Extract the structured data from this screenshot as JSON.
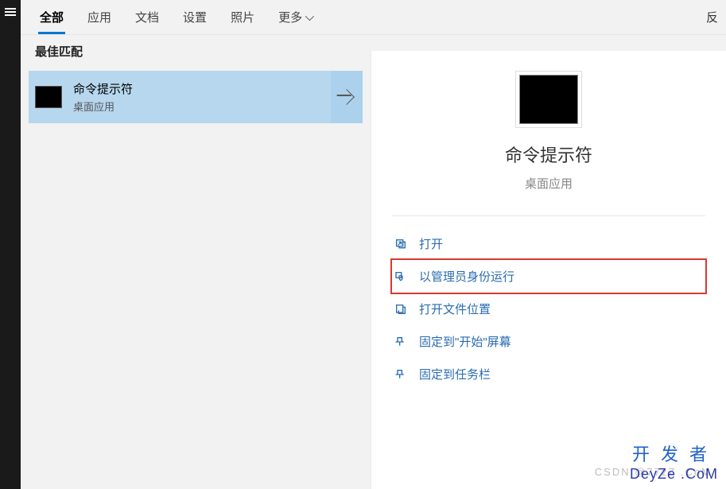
{
  "tabs": {
    "active": "全部",
    "app": "应用",
    "doc": "文档",
    "settings": "设置",
    "photo": "照片",
    "more": "更多",
    "feedback": "反"
  },
  "section": {
    "best_match": "最佳匹配"
  },
  "result": {
    "title": "命令提示符",
    "subtitle": "桌面应用"
  },
  "detail": {
    "title": "命令提示符",
    "subtitle": "桌面应用"
  },
  "actions": {
    "open": "打开",
    "run_admin": "以管理员身份运行",
    "open_location": "打开文件位置",
    "pin_start": "固定到\"开始\"屏幕",
    "pin_taskbar": "固定到任务栏"
  },
  "watermark": {
    "line1": "开发者",
    "line2": "DeyZe .CoM",
    "faint": "CSDN @77zZ .CoM"
  }
}
